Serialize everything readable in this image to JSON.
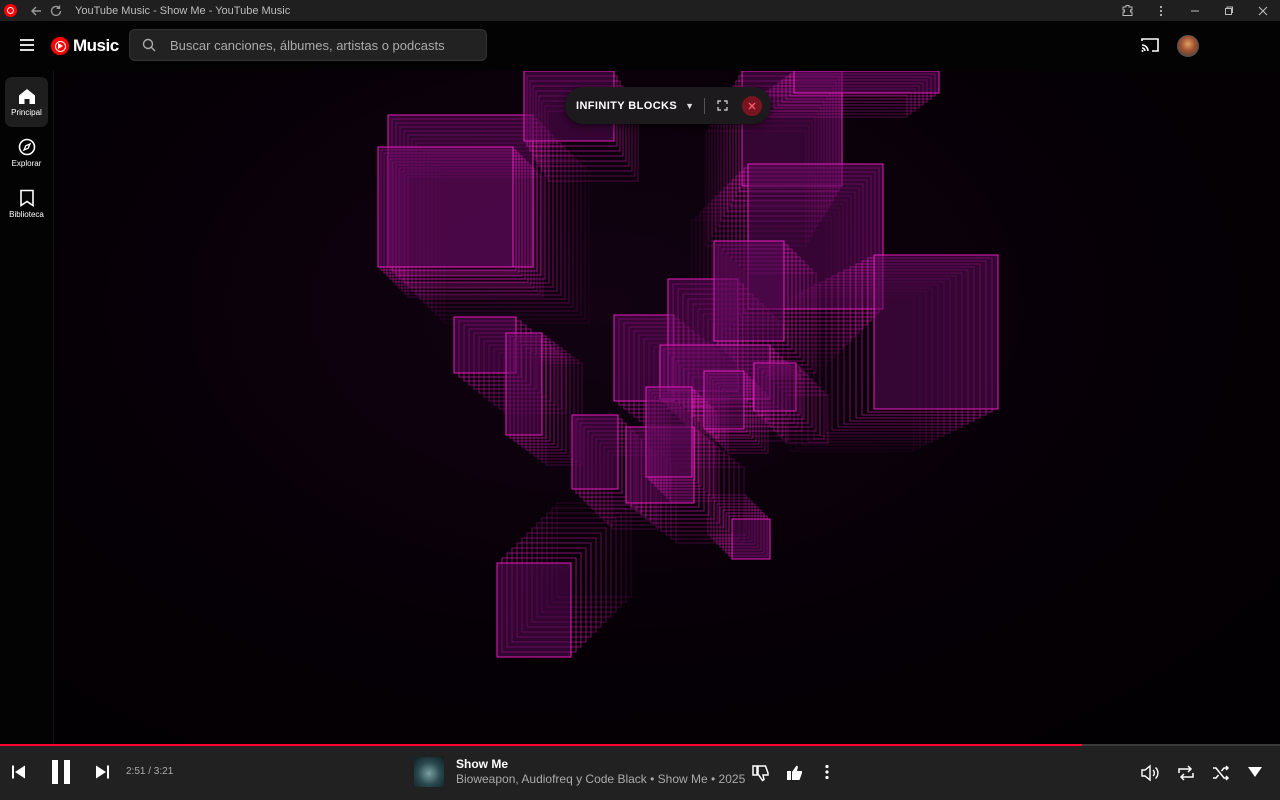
{
  "window": {
    "title": "YouTube Music - Show Me - YouTube Music"
  },
  "header": {
    "logo_text": "Music",
    "search_placeholder": "Buscar canciones, álbumes, artistas o podcasts"
  },
  "sidebar": {
    "items": [
      {
        "label": "Principal",
        "icon": "home-icon",
        "active": true
      },
      {
        "label": "Explorar",
        "icon": "compass-icon",
        "active": false
      },
      {
        "label": "Biblioteca",
        "icon": "bookmark-icon",
        "active": false
      }
    ]
  },
  "visualizer": {
    "name": "INFINITY BLOCKS",
    "caret": "▼",
    "accent": "#ff1fd0"
  },
  "player": {
    "time": "2:51 / 3:21",
    "progress": 0.845,
    "title": "Show Me",
    "subtitle": "Bioweapon, Audiofreq y Code Black • Show Me • 2025",
    "accent": "#ff0033"
  }
}
